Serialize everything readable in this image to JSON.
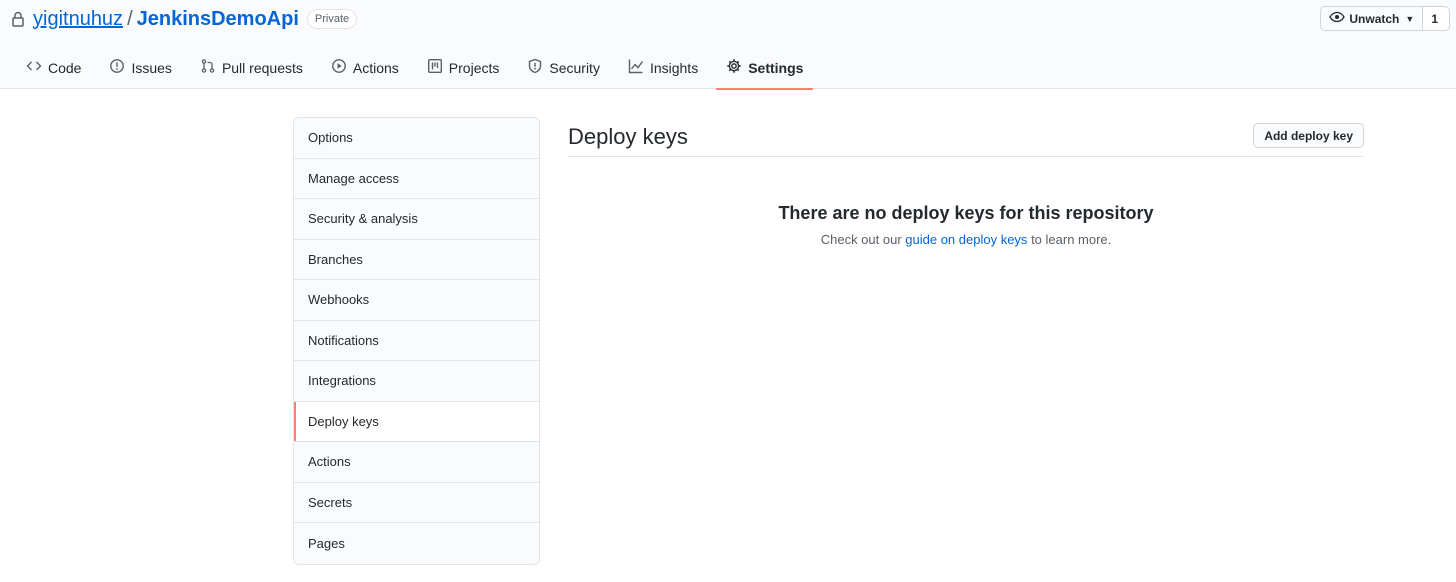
{
  "repo": {
    "owner": "yigitnuhuz",
    "separator": "/",
    "name": "JenkinsDemoApi",
    "visibility": "Private"
  },
  "watch": {
    "label": "Unwatch",
    "count": "1"
  },
  "tabs": [
    {
      "label": "Code",
      "icon": "code-icon"
    },
    {
      "label": "Issues",
      "icon": "issue-icon"
    },
    {
      "label": "Pull requests",
      "icon": "pull-request-icon"
    },
    {
      "label": "Actions",
      "icon": "play-icon"
    },
    {
      "label": "Projects",
      "icon": "project-icon"
    },
    {
      "label": "Security",
      "icon": "shield-icon"
    },
    {
      "label": "Insights",
      "icon": "graph-icon"
    },
    {
      "label": "Settings",
      "icon": "gear-icon",
      "selected": true
    }
  ],
  "menu": [
    {
      "label": "Options"
    },
    {
      "label": "Manage access"
    },
    {
      "label": "Security & analysis"
    },
    {
      "label": "Branches"
    },
    {
      "label": "Webhooks"
    },
    {
      "label": "Notifications"
    },
    {
      "label": "Integrations"
    },
    {
      "label": "Deploy keys",
      "selected": true
    },
    {
      "label": "Actions"
    },
    {
      "label": "Secrets"
    },
    {
      "label": "Pages"
    }
  ],
  "content": {
    "title": "Deploy keys",
    "add_button": "Add deploy key",
    "blank_heading": "There are no deploy keys for this repository",
    "blank_prefix": "Check out our",
    "blank_link": "guide on deploy keys",
    "blank_suffix": "to learn more."
  },
  "colors": {
    "accent": "#f9826c",
    "link": "#0366d6",
    "border": "#e1e4e8"
  }
}
